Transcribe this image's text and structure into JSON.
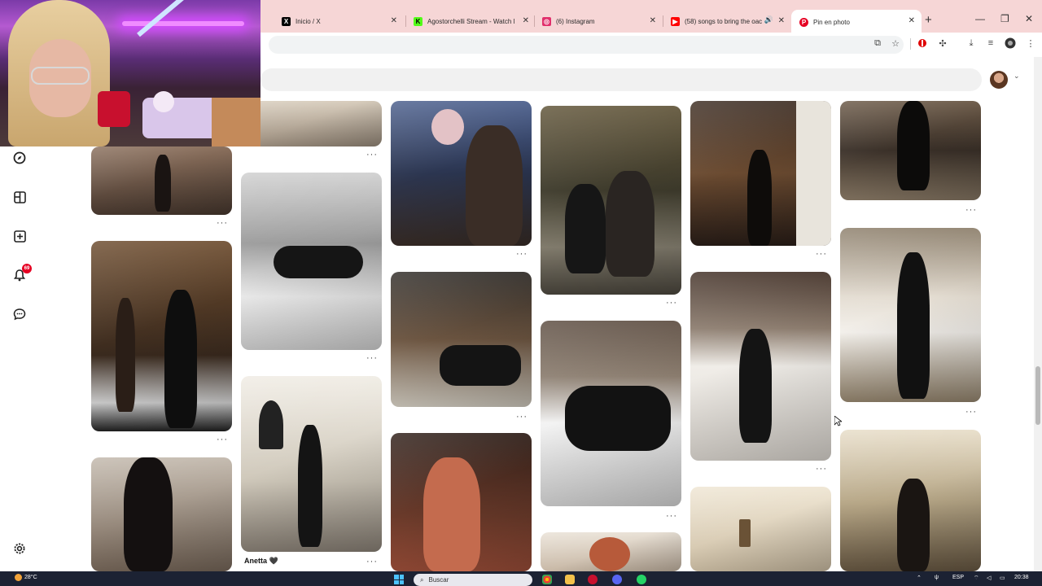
{
  "browser": {
    "tabs": [
      {
        "label": "Inicio / X",
        "icon": "x-logo-icon",
        "color": "#000000"
      },
      {
        "label": "Agostorchelli Stream - Watch l",
        "icon": "kick-logo-icon",
        "color": "#53fc18"
      },
      {
        "label": "(6) Instagram",
        "icon": "instagram-logo-icon",
        "color": "#e1306c"
      },
      {
        "label": "(58) songs to bring the oac",
        "icon": "youtube-logo-icon",
        "color": "#ff0000"
      },
      {
        "label": "Pin en photo",
        "icon": "pinterest-logo-icon",
        "color": "#e60023"
      }
    ],
    "active_tab_index": 4,
    "new_tab_label": "+"
  },
  "pinterest": {
    "notification_count": "69",
    "pin_caption": "Anetta 🖤",
    "more_label": "···",
    "rail_icons": [
      "explore-icon",
      "board-icon",
      "create-icon",
      "notifications-icon",
      "messages-icon",
      "settings-icon"
    ]
  },
  "taskbar": {
    "temperature": "28°C",
    "search_placeholder": "Buscar",
    "language": "ESP",
    "time": "20:38"
  },
  "colors": {
    "accent": "#e60023",
    "tabstrip": "#f6d6d6",
    "taskbar": "#1c2233"
  }
}
